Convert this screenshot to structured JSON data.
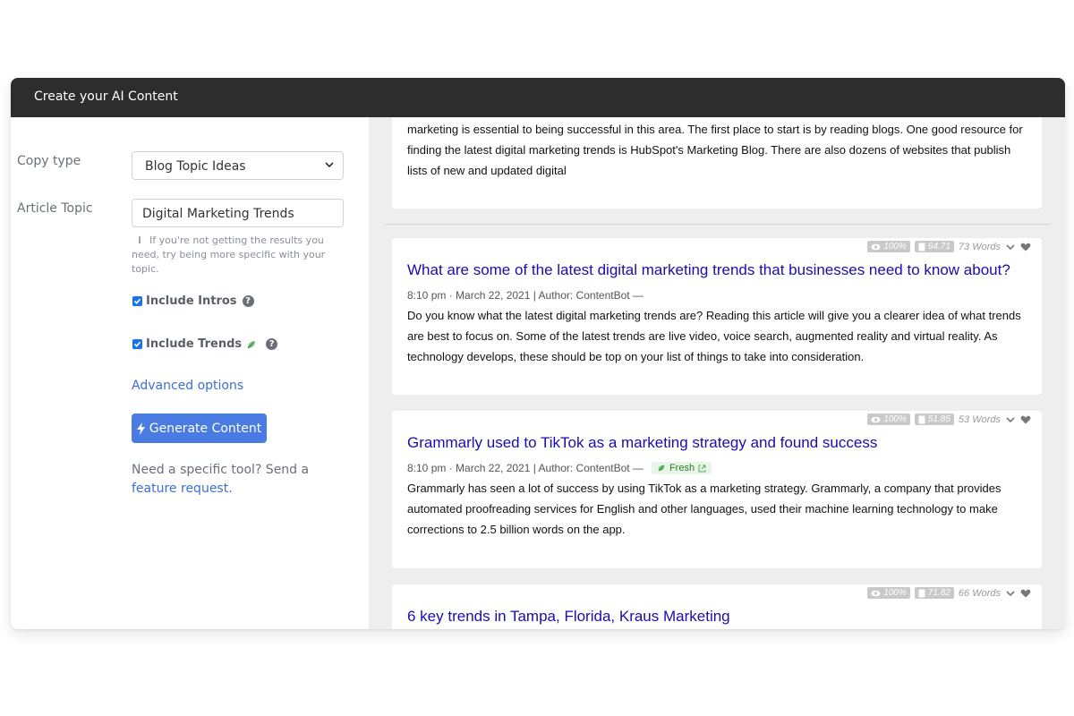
{
  "app": {
    "title": "Create your AI Content"
  },
  "form": {
    "copy_type_label": "Copy type",
    "copy_type_value": "Blog Topic Ideas",
    "topic_label": "Article Topic",
    "topic_value": "Digital Marketing Trends",
    "hint": "If you're not getting the results you need, try being more specific with your topic.",
    "include_intros_label": "Include Intros",
    "include_trends_label": "Include Trends",
    "advanced_options": "Advanced options",
    "generate_label": "Generate Content",
    "need_text": "Need a specific tool? Send a",
    "feature_link": "feature request."
  },
  "results": {
    "partial_text": "marketing is essential to being successful in this area. The first place to start is by reading blogs. One good resource for finding the latest digital marketing trends is HubSpot's Marketing Blog. There are also dozens of websites that publish lists of new and updated digital",
    "items": [
      {
        "title": "What are some of the latest digital marketing trends that businesses need to know about?",
        "byline": "8:10 pm · March 22, 2021 | Author: ContentBot —",
        "body": "Do you know what the latest digital marketing trends are? Reading this article will give you a clearer idea of what trends are best to focus on. Some of the latest trends are live video, voice search, augmented reality and virtual reality. As technology develops, these should be top on your list of things to take into consideration.",
        "uniqueness": "100%",
        "readability": "64.71",
        "words": "73 Words"
      },
      {
        "title": "Grammarly used to TikTok as a marketing strategy and found success",
        "byline": "8:10 pm · March 22, 2021 | Author: ContentBot —",
        "badge": "Fresh",
        "body": "Grammarly has seen a lot of success by using TikTok as a marketing strategy. Grammarly, a company that provides automated proofreading services for English and other languages, used their machine learning technology to make corrections to 2.5 billion words on the app.",
        "uniqueness": "100%",
        "readability": "51.85",
        "words": "53 Words"
      },
      {
        "title": "6 key trends in Tampa, Florida, Kraus Marketing",
        "uniqueness": "100%",
        "readability": "71.82",
        "words": "66 Words"
      }
    ]
  },
  "colors": {
    "topbar": "#2d2d2d",
    "accent": "#4a7be2",
    "link": "#1a0dab",
    "panel_bg": "#eeeeee"
  }
}
